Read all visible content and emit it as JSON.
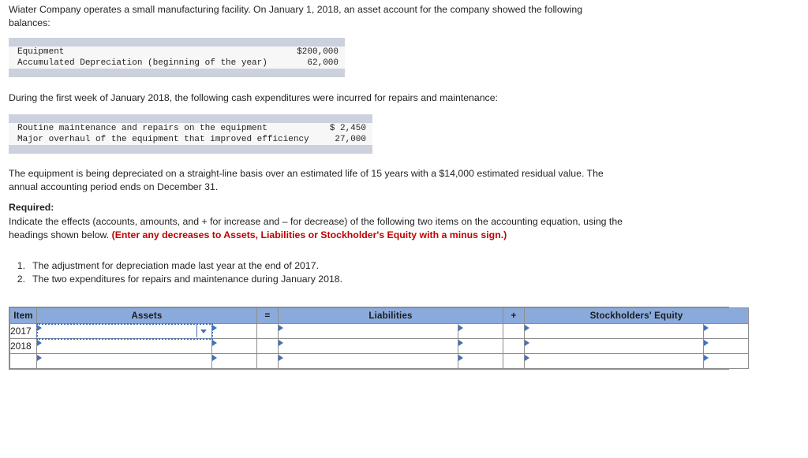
{
  "problem": {
    "intro": "Wiater Company operates a small manufacturing facility. On January 1, 2018, an asset account for the company showed the following balances:",
    "during": "During the first week of January 2018, the following cash expenditures were incurred for repairs and maintenance:",
    "depreciation": "The equipment is being depreciated on a straight-line basis over an estimated life of 15 years with a $14,000 estimated residual value. The annual accounting period ends on December 31.",
    "required_label": "Required:",
    "indicate_text": "Indicate the effects (accounts, amounts, and + for increase and – for decrease) of the following two items on the accounting equation, using the headings shown below.",
    "indicate_warning": "(Enter any decreases to Assets, Liabilities or Stockholder's Equity with a minus sign.)",
    "items": [
      {
        "num": "1.",
        "text": "The adjustment for depreciation made last year at the end of 2017."
      },
      {
        "num": "2.",
        "text": "The two expenditures for repairs and maintenance during January 2018."
      }
    ]
  },
  "balances_table": {
    "rows": [
      {
        "label": "Equipment",
        "value": "$200,000"
      },
      {
        "label": "Accumulated Depreciation (beginning of the year)",
        "value": "62,000"
      }
    ]
  },
  "expenditures_table": {
    "rows": [
      {
        "label": "Routine maintenance and repairs on the equipment",
        "value": "$ 2,450"
      },
      {
        "label": "Major overhaul of the equipment that improved efficiency",
        "value": "27,000"
      }
    ]
  },
  "answer_grid": {
    "headers": {
      "item": "Item",
      "assets": "Assets",
      "equals": "=",
      "liabilities": "Liabilities",
      "plus": "+",
      "equity": "Stockholders' Equity"
    },
    "rows": [
      {
        "item": "2017",
        "assets_text": "",
        "assets_amount": "",
        "liabilities_text": "",
        "liabilities_amount": "",
        "equity_text": "",
        "equity_amount": ""
      },
      {
        "item": "2018",
        "assets_text": "",
        "assets_amount": "",
        "liabilities_text": "",
        "liabilities_amount": "",
        "equity_text": "",
        "equity_amount": ""
      },
      {
        "item": "",
        "assets_text": "",
        "assets_amount": "",
        "liabilities_text": "",
        "liabilities_amount": "",
        "equity_text": "",
        "equity_amount": ""
      }
    ],
    "selected_cell": "row0-assets-text",
    "colors": {
      "header_fill": "#8aaadc",
      "grid_border": "#8d8d8d",
      "selection": "#3f6fbd",
      "caret": "#4371b8"
    }
  },
  "colors": {
    "warning_red": "#c00000",
    "table_band": "#ccd1dd",
    "table_fill": "#f7f7f8",
    "text": "#231f20"
  }
}
